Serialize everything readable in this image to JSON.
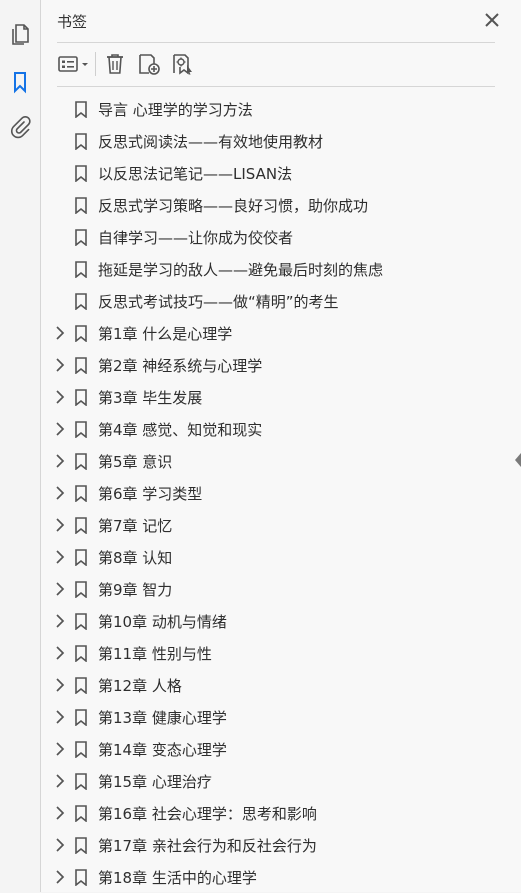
{
  "panel": {
    "title": "书签"
  },
  "icons": {
    "rail": [
      "pages-icon",
      "bookmark-icon",
      "attachment-icon"
    ],
    "toolbar": [
      "options-list-icon",
      "delete-icon",
      "new-bookmark-icon",
      "bookmark-from-structure-icon"
    ]
  },
  "colors": {
    "accent": "#1473e6",
    "icon": "#555555"
  },
  "bookmarks": [
    {
      "label": "导言  心理学的学习方法",
      "expandable": false
    },
    {
      "label": "反思式阅读法——有效地使用教材",
      "expandable": false
    },
    {
      "label": "以反思法记笔记——LISAN法",
      "expandable": false
    },
    {
      "label": "反思式学习策略——良好习惯，助你成功",
      "expandable": false
    },
    {
      "label": "自律学习——让你成为佼佼者",
      "expandable": false
    },
    {
      "label": "拖延是学习的敌人——避免最后时刻的焦虑",
      "expandable": false
    },
    {
      "label": "反思式考试技巧——做“精明”的考生",
      "expandable": false
    },
    {
      "label": "第1章  什么是心理学",
      "expandable": true
    },
    {
      "label": "第2章  神经系统与心理学",
      "expandable": true
    },
    {
      "label": "第3章  毕生发展",
      "expandable": true
    },
    {
      "label": "第4章  感觉、知觉和现实",
      "expandable": true
    },
    {
      "label": "第5章  意识",
      "expandable": true
    },
    {
      "label": "第6章  学习类型",
      "expandable": true
    },
    {
      "label": "第7章  记忆",
      "expandable": true
    },
    {
      "label": "第8章  认知",
      "expandable": true
    },
    {
      "label": "第9章  智力",
      "expandable": true
    },
    {
      "label": "第10章  动机与情绪",
      "expandable": true
    },
    {
      "label": "第11章  性别与性",
      "expandable": true
    },
    {
      "label": "第12章  人格",
      "expandable": true
    },
    {
      "label": "第13章  健康心理学",
      "expandable": true
    },
    {
      "label": "第14章  变态心理学",
      "expandable": true
    },
    {
      "label": "第15章  心理治疗",
      "expandable": true
    },
    {
      "label": "第16章  社会心理学：思考和影响",
      "expandable": true
    },
    {
      "label": "第17章  亲社会行为和反社会行为",
      "expandable": true
    },
    {
      "label": "第18章  生活中的心理学",
      "expandable": true
    }
  ]
}
